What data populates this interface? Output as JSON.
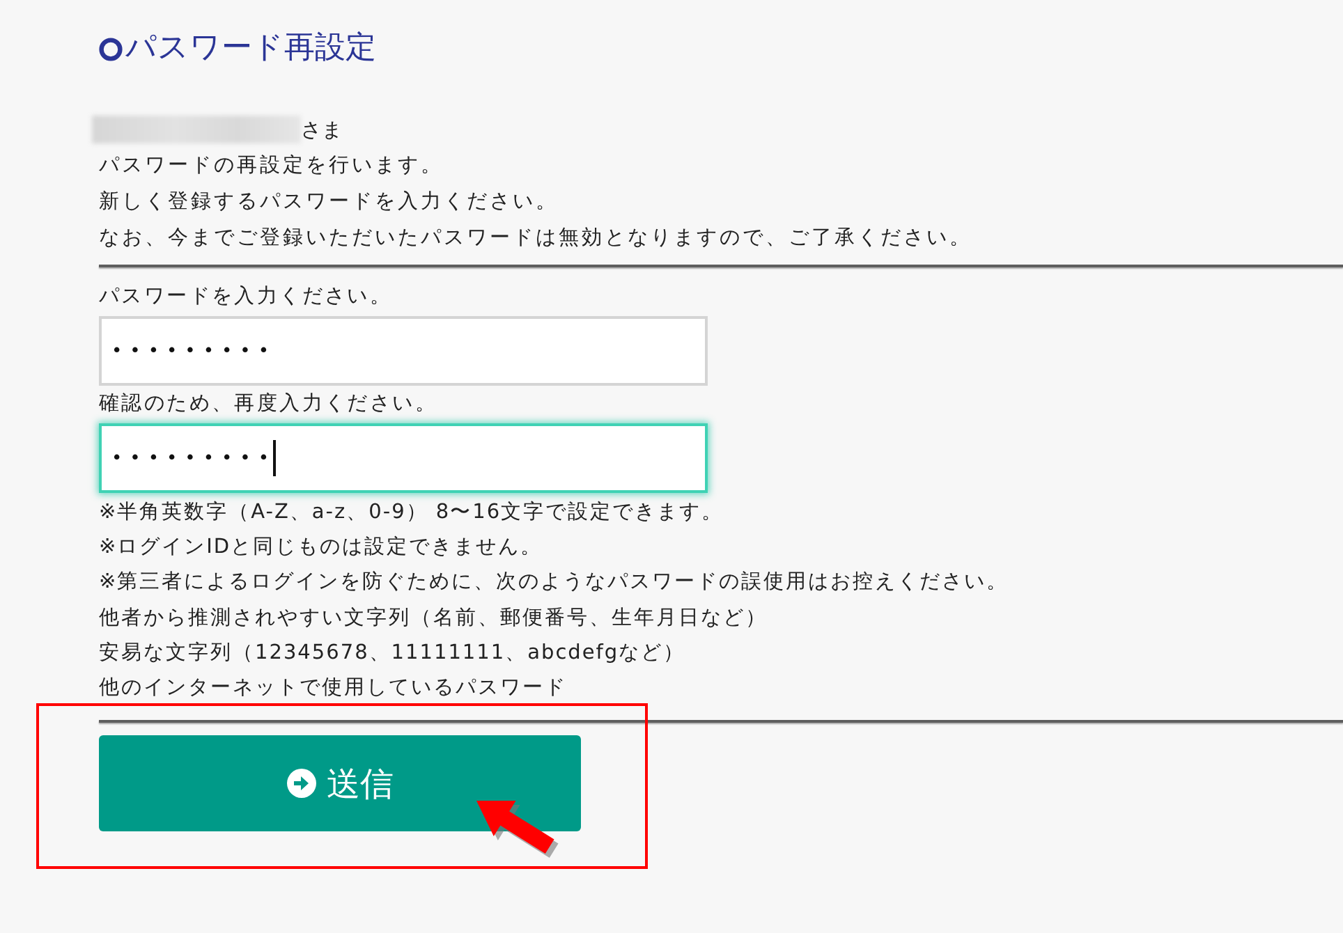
{
  "title": "パスワード再設定",
  "greeting": {
    "honorific": "さま"
  },
  "intro": [
    "パスワードの再設定を行います。",
    "新しく登録するパスワードを入力ください。",
    "なお、今までご登録いただいたパスワードは無効となりますので、ご了承ください。"
  ],
  "fields": [
    {
      "label": "パスワードを入力ください。",
      "value": "•••••••••",
      "focused": false
    },
    {
      "label": "確認のため、再度入力ください。",
      "value": "•••••••••",
      "focused": true
    }
  ],
  "notes": [
    "※半角英数字（A-Z、a-z、0-9） 8〜16文字で設定できます。",
    "※ログインIDと同じものは設定できません。",
    "※第三者によるログインを防ぐために、次のようなパスワードの誤使用はお控えください。",
    "他者から推測されやすい文字列（名前、郵便番号、生年月日など）",
    "安易な文字列（12345678、11111111、abcdefgなど）",
    "他のインターネットで使用しているパスワード"
  ],
  "submit_button": {
    "label": "送信"
  }
}
